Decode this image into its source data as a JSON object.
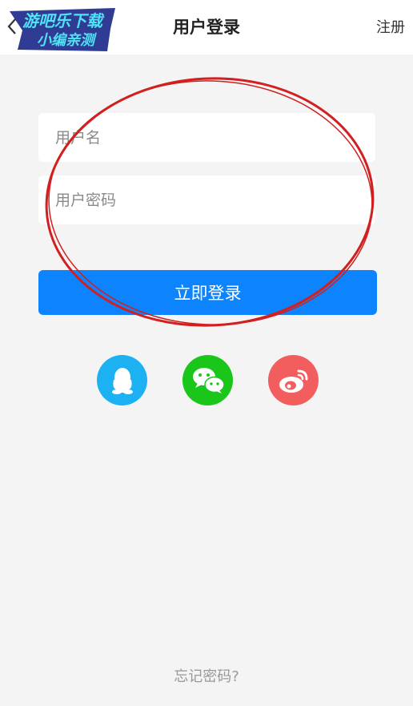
{
  "header": {
    "title": "用户登录",
    "register_label": "注册",
    "back_icon": "chevron-left-icon"
  },
  "watermark": {
    "line1": "游吧乐下载",
    "line2": "小编亲测"
  },
  "form": {
    "username_placeholder": "用户名",
    "password_placeholder": "用户密码",
    "login_label": "立即登录"
  },
  "social": [
    {
      "name": "qq",
      "icon": "qq-icon",
      "color": "#1bb1f2"
    },
    {
      "name": "wechat",
      "icon": "wechat-icon",
      "color": "#1ac61a"
    },
    {
      "name": "weibo",
      "icon": "weibo-icon",
      "color": "#f25e5e"
    }
  ],
  "footer": {
    "forgot_label": "忘记密码?"
  },
  "colors": {
    "primary": "#0d84fe",
    "background": "#f4f4f4",
    "annotation": "#d21f1f"
  }
}
